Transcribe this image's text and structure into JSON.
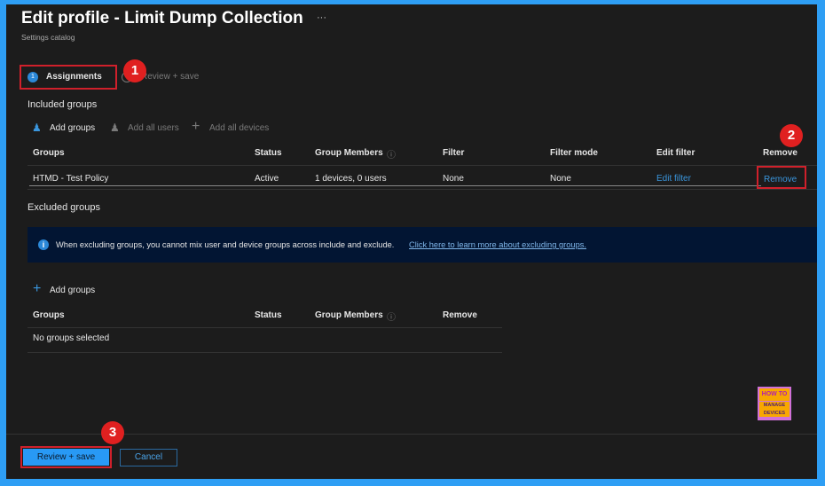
{
  "header": {
    "title": "Edit profile - Limit Dump Collection",
    "more": "···",
    "subtitle": "Settings catalog"
  },
  "steps": [
    {
      "number": "1",
      "label": "Assignments"
    },
    {
      "label": "Review + save"
    }
  ],
  "callouts": [
    "1",
    "2",
    "3"
  ],
  "included": {
    "title": "Included groups",
    "toolbar": {
      "add_groups": "Add groups",
      "add_all_users": "Add all users",
      "add_all_devices": "Add all devices"
    },
    "columns": [
      "Groups",
      "Status",
      "Group Members",
      "Filter",
      "Filter mode",
      "Edit filter",
      "Remove"
    ],
    "rows": [
      {
        "group": "HTMD - Test Policy",
        "status": "Active",
        "members": "1 devices, 0 users",
        "filter": "None",
        "filter_mode": "None",
        "edit_filter": "Edit filter",
        "remove": "Remove"
      }
    ]
  },
  "excluded": {
    "title": "Excluded groups",
    "info": "When excluding groups, you cannot mix user and device groups across include and exclude.",
    "info_link": "Click here to learn more about excluding groups.",
    "add_groups": "Add groups",
    "columns": [
      "Groups",
      "Status",
      "Group Members",
      "Remove"
    ],
    "empty": "No groups selected"
  },
  "logo": {
    "line1": "HOW TO",
    "line2": "MANAGE",
    "line3": "DEVICES"
  },
  "footer": {
    "review_save": "Review + save",
    "cancel": "Cancel"
  },
  "colors": {
    "accent": "#2899f5",
    "callout": "#e02020",
    "frame": "#2e9ef4"
  }
}
